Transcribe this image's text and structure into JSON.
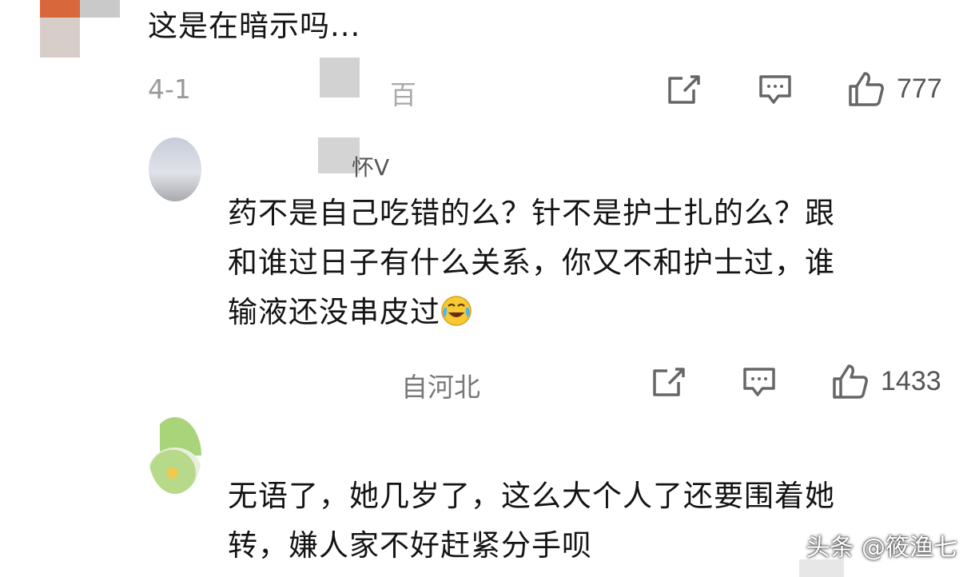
{
  "comments": [
    {
      "text": "这是在暗示吗...",
      "meta_date": "4-1",
      "meta_location": "百",
      "like_count": "777"
    },
    {
      "username": "怀V",
      "text": "药不是自己吃错的么？针不是护士扎的么？跟\n和谁过日子有什么关系，你又不和护士过，谁\n输液还没串皮过",
      "meta_location": "自河北",
      "like_count": "1433"
    },
    {
      "text": "无语了，她几岁了，这么大个人了还要围着她\n转，嫌人家不好赶紧分手呗"
    }
  ],
  "watermark": "头条 @筱渔七",
  "icons": {
    "share": "share-icon",
    "reply": "reply-icon",
    "like": "thumbs-up-icon",
    "emoji": "laughing-tears-emoji"
  },
  "colors": {
    "text": "#141414",
    "meta": "#8a8a8a",
    "icon": "#555555"
  }
}
